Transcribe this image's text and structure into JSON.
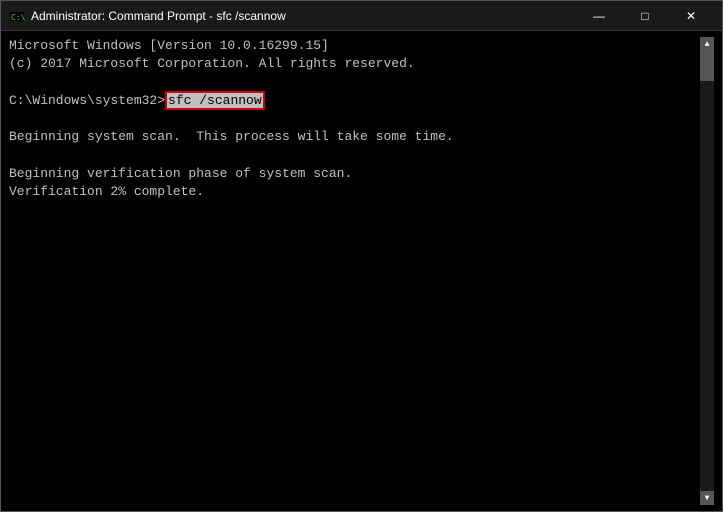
{
  "titleBar": {
    "icon": "cmd-icon",
    "title": "Administrator: Command Prompt - sfc /scannow",
    "minimizeLabel": "—",
    "maximizeLabel": "□",
    "closeLabel": "✕"
  },
  "terminal": {
    "lines": [
      "Microsoft Windows [Version 10.0.16299.15]",
      "(c) 2017 Microsoft Corporation. All rights reserved.",
      "",
      "C:\\Windows\\system32>sfc /scannow",
      "",
      "Beginning system scan.  This process will take some time.",
      "",
      "Beginning verification phase of system scan.",
      "Verification 2% complete.",
      "",
      "",
      "",
      "",
      "",
      "",
      "",
      "",
      "",
      "",
      "",
      "",
      "",
      "",
      "",
      "",
      ""
    ],
    "prompt": "C:\\Windows\\system32>",
    "command": "sfc /scannow"
  },
  "colors": {
    "background": "#000000",
    "text": "#c0c0c0",
    "titleBar": "#1a1a1a",
    "commandHighlight": "#cc0000",
    "titleBarText": "#ffffff"
  }
}
